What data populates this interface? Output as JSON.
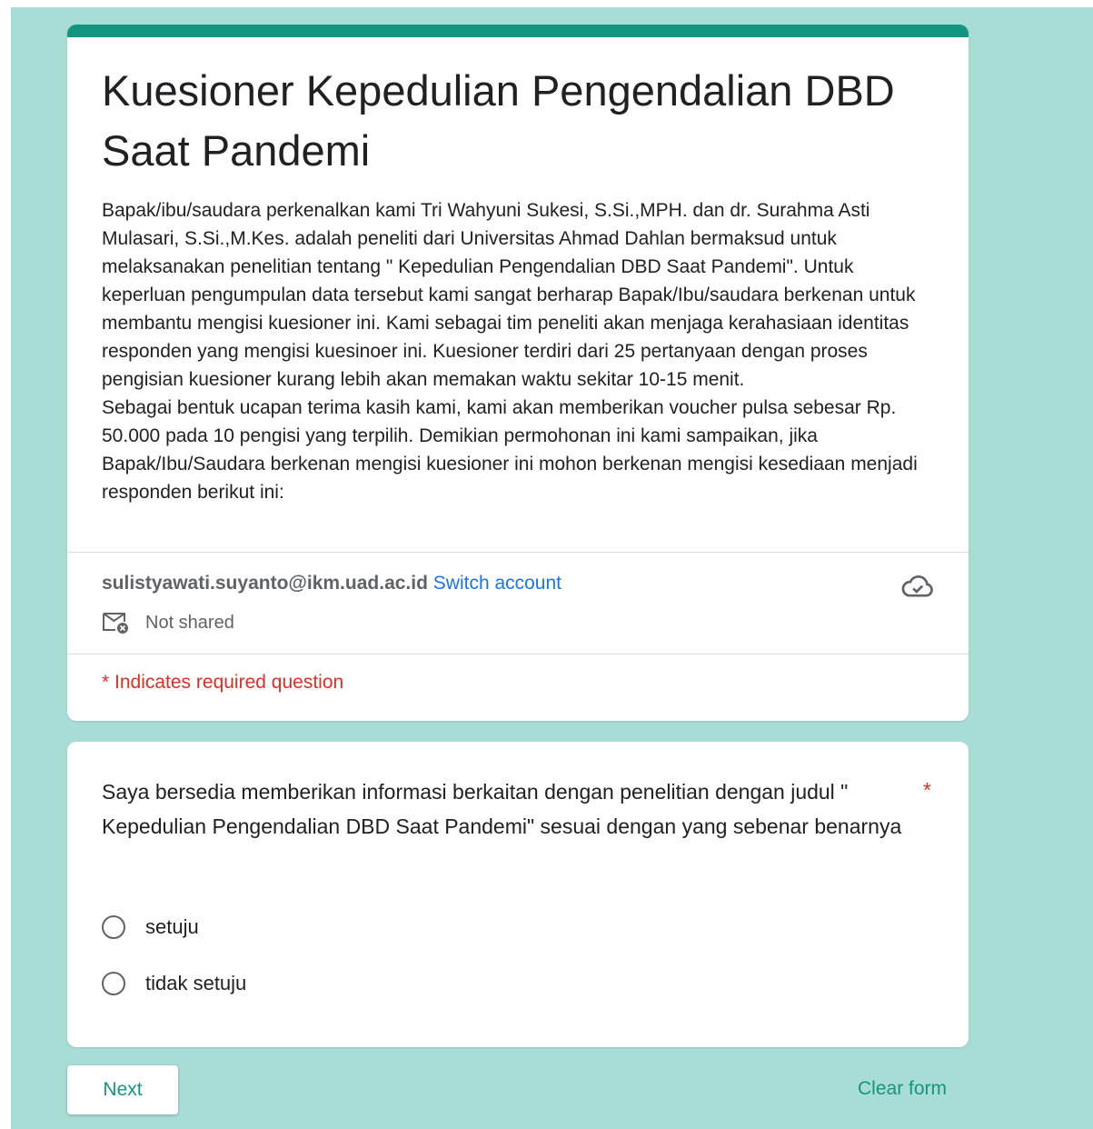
{
  "form": {
    "title_line1": "Kuesioner Kepedulian Pengendalian DBD",
    "title_line2": "Saat Pandemi",
    "description_p1": "Bapak/ibu/saudara perkenalkan kami Tri Wahyuni Sukesi, S.Si.,MPH. dan dr. Surahma Asti Mulasari, S.Si.,M.Kes. adalah peneliti dari Universitas Ahmad Dahlan bermaksud untuk melaksanakan penelitian tentang \" Kepedulian Pengendalian DBD Saat Pandemi\". Untuk keperluan pengumpulan data tersebut kami sangat berharap Bapak/Ibu/saudara berkenan untuk membantu mengisi kuesioner ini. Kami sebagai tim peneliti akan menjaga kerahasiaan identitas responden yang mengisi kuesinoer ini. Kuesioner terdiri dari 25 pertanyaan dengan proses pengisian kuesioner kurang lebih akan memakan waktu sekitar 10-15 menit.",
    "description_p2": "Sebagai bentuk ucapan terima kasih kami, kami akan memberikan voucher pulsa sebesar Rp. 50.000 pada 10 pengisi yang terpilih. Demikian permohonan ini kami sampaikan, jika Bapak/Ibu/Saudara berkenan mengisi kuesioner ini mohon berkenan mengisi kesediaan menjadi responden berikut ini:"
  },
  "account": {
    "email": "sulistyawati.suyanto@ikm.uad.ac.id",
    "switch_label": "Switch account",
    "shared_status": "Not shared",
    "cloud_icon": "cloud-done-icon"
  },
  "required_note": "* Indicates required question",
  "question": {
    "text": "Saya bersedia memberikan informasi berkaitan dengan penelitian dengan judul \" Kepedulian Pengendalian DBD Saat Pandemi\" sesuai dengan yang sebenar benarnya",
    "required_mark": "*",
    "options": [
      "setuju",
      "tidak setuju"
    ]
  },
  "buttons": {
    "next": "Next",
    "clear": "Clear form"
  },
  "colors": {
    "accent": "#14957f",
    "background": "#a8ddd6",
    "required": "#d93025",
    "link": "#1a73e8"
  }
}
